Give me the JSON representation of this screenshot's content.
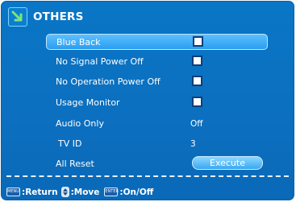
{
  "header": {
    "title": "OTHERS",
    "icon": "arrow-down-right-icon"
  },
  "menu": {
    "items": [
      {
        "label": "Blue Back",
        "control": "checkbox",
        "checked": false,
        "selected": true
      },
      {
        "label": "No Signal Power Off",
        "control": "checkbox",
        "checked": false
      },
      {
        "label": "No Operation Power Off",
        "control": "checkbox",
        "checked": false
      },
      {
        "label": "Usage Monitor",
        "control": "checkbox",
        "checked": false
      },
      {
        "label": "Audio Only",
        "value": "Off"
      },
      {
        "label": "TV ID",
        "value": "3"
      },
      {
        "label": "All Reset",
        "button": "Execute"
      }
    ]
  },
  "footer": {
    "menu_key": "MENU",
    "return_label": ":Return",
    "move_label": ":Move",
    "enter_key": "ENTER",
    "onoff_label": ":On/Off"
  },
  "colors": {
    "panel": "#0c6fbf",
    "highlight": "#2a9df0",
    "text": "#ffffff"
  }
}
